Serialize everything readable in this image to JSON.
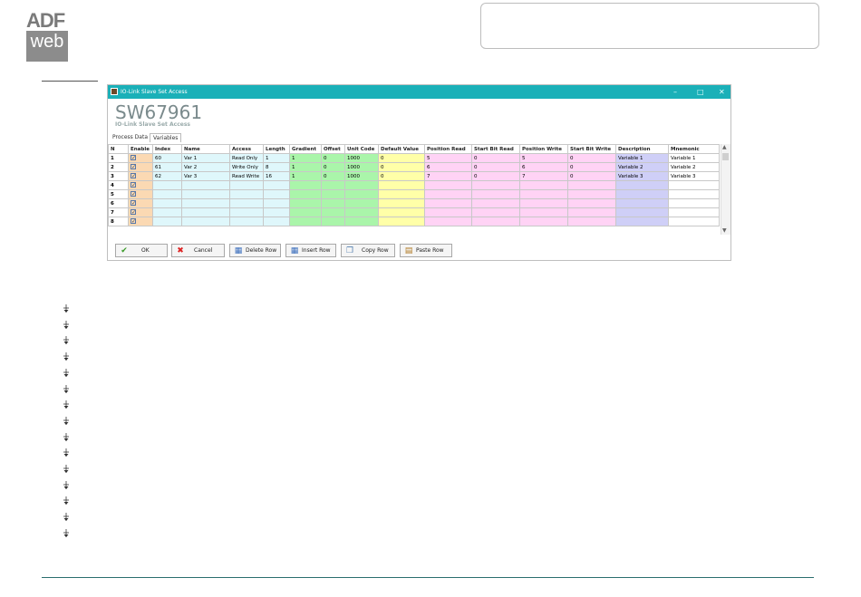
{
  "logo": {
    "top_text": "ADF",
    "bottom_text": "web"
  },
  "window": {
    "title": "IO-Link Slave Set Access",
    "controls": {
      "minimize": "–",
      "maximize": "□",
      "close": "✕"
    },
    "product_code": "SW67961",
    "subtitle": "IO-Link Slave Set Access",
    "tabs": [
      {
        "label": "Process Data",
        "active": false
      },
      {
        "label": "Variables",
        "active": true
      }
    ]
  },
  "grid": {
    "columns": [
      "N",
      "Enable",
      "Index",
      "Name",
      "Access",
      "Length",
      "Gradient",
      "Offset",
      "Unit Code",
      "Default Value",
      "Position Read",
      "Start Bit Read",
      "Position Write",
      "Start Bit Write",
      "Description",
      "Mnemonic"
    ],
    "rows": [
      [
        "1",
        "",
        "60",
        "Var 1",
        "Read Only",
        "1",
        "1",
        "0",
        "1000",
        "0",
        "5",
        "0",
        "5",
        "0",
        "Variable 1",
        "Variable 1"
      ],
      [
        "2",
        "",
        "61",
        "Var 2",
        "Write Only",
        "8",
        "1",
        "0",
        "1000",
        "0",
        "6",
        "0",
        "6",
        "0",
        "Variable 2",
        "Variable 2"
      ],
      [
        "3",
        "",
        "62",
        "Var 3",
        "Read Write",
        "16",
        "1",
        "0",
        "1000",
        "0",
        "7",
        "0",
        "7",
        "0",
        "Variable 3",
        "Variable 3"
      ],
      [
        "4",
        "",
        "",
        "",
        "",
        "",
        "",
        "",
        "",
        "",
        "",
        "",
        "",
        "",
        "",
        ""
      ],
      [
        "5",
        "",
        "",
        "",
        "",
        "",
        "",
        "",
        "",
        "",
        "",
        "",
        "",
        "",
        "",
        ""
      ],
      [
        "6",
        "",
        "",
        "",
        "",
        "",
        "",
        "",
        "",
        "",
        "",
        "",
        "",
        "",
        "",
        ""
      ],
      [
        "7",
        "",
        "",
        "",
        "",
        "",
        "",
        "",
        "",
        "",
        "",
        "",
        "",
        "",
        "",
        ""
      ],
      [
        "8",
        "",
        "",
        "",
        "",
        "",
        "",
        "",
        "",
        "",
        "",
        "",
        "",
        "",
        "",
        ""
      ]
    ]
  },
  "buttons": [
    {
      "label": "OK",
      "icon": "check-icon"
    },
    {
      "label": "Cancel",
      "icon": "x-icon"
    },
    {
      "label": "Delete Row",
      "icon": "delete-row-icon"
    },
    {
      "label": "Insert Row",
      "icon": "insert-row-icon"
    },
    {
      "label": "Copy Row",
      "icon": "copy-icon"
    },
    {
      "label": "Paste Row",
      "icon": "paste-icon"
    }
  ],
  "bullet_count": 15,
  "colors": {
    "titlebar": "#1ab0b8",
    "enable": "#fbd9b3",
    "index_name": "#dff7fb",
    "gradient": "#aaf5aa",
    "default": "#ffffa8",
    "position": "#ffd3f5",
    "description": "#cfcff7",
    "footer_rule": "#2a6e6e"
  }
}
